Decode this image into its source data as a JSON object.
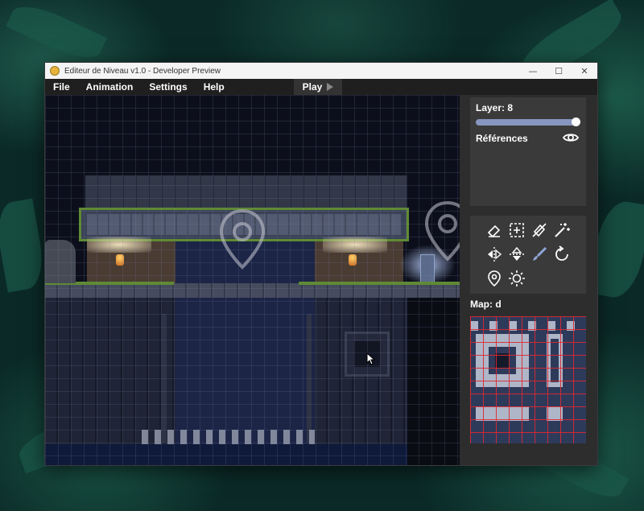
{
  "window": {
    "title": "Editeur de Niveau v1.0 - Developer Preview",
    "controls": {
      "minimize": "—",
      "maximize": "☐",
      "close": "✕"
    }
  },
  "menu": {
    "items": [
      "File",
      "Animation",
      "Settings",
      "Help"
    ],
    "play_label": "Play"
  },
  "layer_panel": {
    "layer_label": "Layer: 8",
    "slider_fraction": 1.0,
    "references_label": "Références",
    "references_icon": "eye-icon"
  },
  "tools": [
    "eraser-icon",
    "selection-icon",
    "fill-erase-icon",
    "magic-wand-icon",
    "flip-horizontal-icon",
    "flip-vertical-icon",
    "brush-icon",
    "rotate-icon",
    "map-pin-icon",
    "brightness-icon"
  ],
  "map": {
    "label": "Map: d"
  },
  "colors": {
    "accent": "#8796bf",
    "canvas_bg": "#0c0f1b",
    "panel_bg": "#3a3a3a",
    "moss": "#6f9a3a",
    "tileset_grid": "#dc2832"
  }
}
